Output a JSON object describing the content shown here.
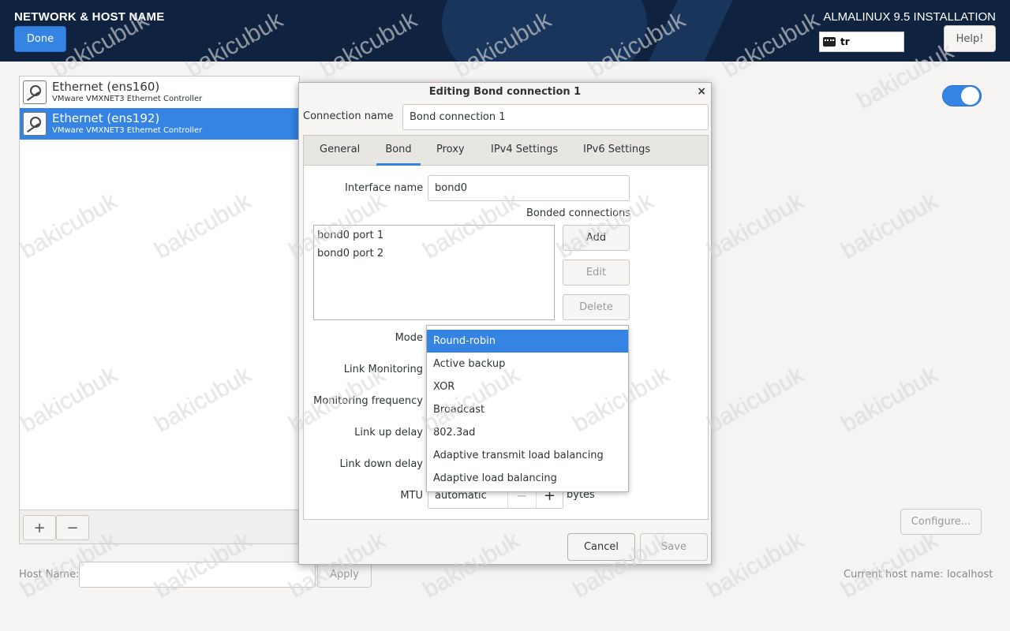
{
  "header": {
    "page_title": "NETWORK & HOST NAME",
    "done_label": "Done",
    "install_title": "ALMALINUX 9.5 INSTALLATION",
    "keyboard_layout": "tr",
    "help_label": "Help!"
  },
  "interfaces": [
    {
      "name": "Ethernet (ens160)",
      "desc": "VMware VMXNET3 Ethernet Controller",
      "selected": false
    },
    {
      "name": "Ethernet (ens192)",
      "desc": "VMware VMXNET3 Ethernet Controller",
      "selected": true
    }
  ],
  "list_toolbar": {
    "add_label": "+",
    "remove_label": "−"
  },
  "right_panel": {
    "toggle_on": true,
    "configure_label": "Configure..."
  },
  "hostname": {
    "label": "Host Name:",
    "value": "",
    "apply_label": "Apply",
    "current_label": "Current host name:",
    "current_value": "localhost"
  },
  "dialog": {
    "title": "Editing Bond connection 1",
    "close_icon": "×",
    "connection_name_label": "Connection name",
    "connection_name_value": "Bond connection 1",
    "tabs": [
      "General",
      "Bond",
      "Proxy",
      "IPv4 Settings",
      "IPv6 Settings"
    ],
    "active_tab": "Bond",
    "interface_name_label": "Interface name",
    "interface_name_value": "bond0",
    "bonded_connections_label": "Bonded connections",
    "bonded_connections": [
      "bond0 port 1",
      "bond0 port 2"
    ],
    "add_label": "Add",
    "edit_label": "Edit",
    "delete_label": "Delete",
    "mode_label": "Mode",
    "link_monitoring_label": "Link Monitoring",
    "monitoring_frequency_label": "Monitoring frequency",
    "link_up_delay_label": "Link up delay",
    "link_down_delay_label": "Link down delay",
    "mtu_label": "MTU",
    "mtu_value": "automatic",
    "mtu_minus": "−",
    "mtu_plus": "+",
    "mtu_unit": "bytes",
    "cancel_label": "Cancel",
    "save_label": "Save"
  },
  "mode_dropdown": {
    "options": [
      "Round-robin",
      "Active backup",
      "XOR",
      "Broadcast",
      "802.3ad",
      "Adaptive transmit load balancing",
      "Adaptive load balancing"
    ],
    "selected": "Round-robin"
  },
  "watermark": "bakicubuk",
  "colors": {
    "accent": "#3584e4",
    "header_bg": "#0f2340"
  }
}
